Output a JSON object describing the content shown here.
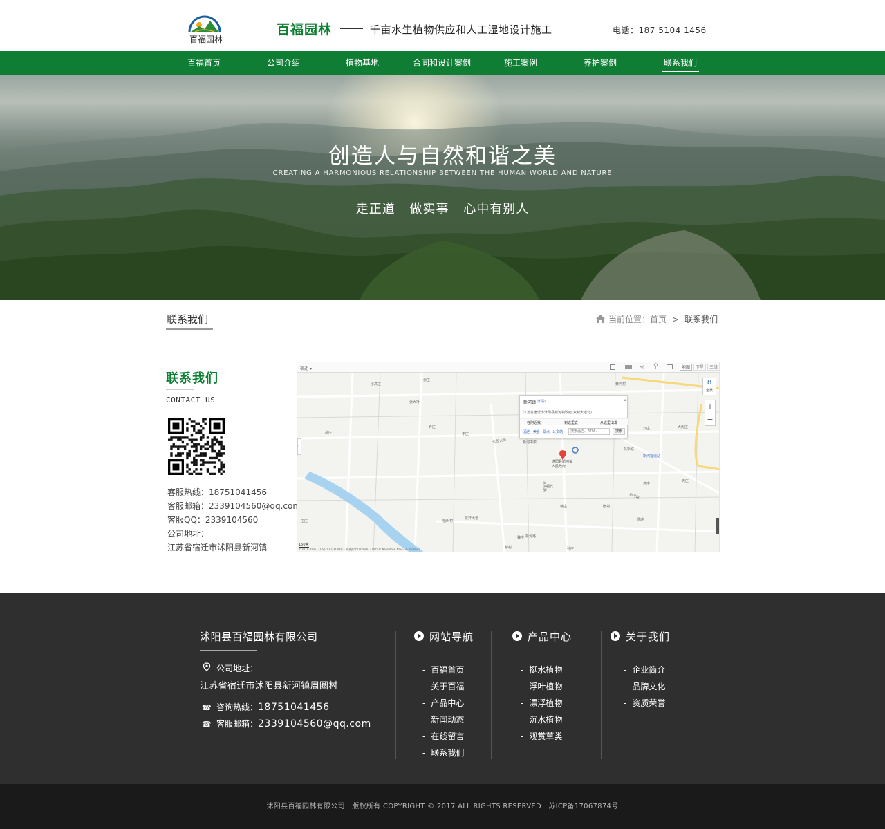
{
  "header": {
    "logo_text": "百福园林",
    "brand": "百福园林",
    "tagline": "千亩水生植物供应和人工湿地设计施工",
    "phone": "电话：187 5104 1456"
  },
  "nav": {
    "items": [
      "百福首页",
      "公司介绍",
      "植物基地",
      "合同和设计案例",
      "施工案例",
      "养护案例",
      "联系我们"
    ],
    "active": "联系我们"
  },
  "banner": {
    "title": "创造人与自然和谐之美",
    "subtitle": "CREATING A HARMONIOUS RELATIONSHIP BETWEEN THE HUMAN WORLD AND NATURE",
    "slogan": "走正道 做实事 心中有别人"
  },
  "section": {
    "title": "联系我们",
    "breadcrumb_label": "当前位置：",
    "breadcrumb_home": "首页",
    "breadcrumb_sep": ">",
    "breadcrumb_current": "联系我们"
  },
  "contact": {
    "title": "联系我们",
    "subtitle": "CONTACT US",
    "hotline": "客服热线：18751041456",
    "email": "客服邮箱：2339104560@qq.com",
    "qq": "客服QQ：2339104560",
    "address_label": "公司地址：",
    "address": "江苏省宿迁市沭阳县新河镇"
  },
  "map": {
    "city_select": "宿迁 ▾",
    "view_buttons": [
      "地图",
      "卫星",
      "三维"
    ],
    "popup_title": "新河镇",
    "popup_detail": "详情»",
    "popup_address": "江苏省宿迁市沭阳县新河镇政府(双新大道北)",
    "popup_actions": [
      "在附近找",
      "到这里去",
      "从这里出发"
    ],
    "popup_links": [
      "酒店",
      "美食",
      "景点",
      "公交站"
    ],
    "popup_search_placeholder": "搜索酒店、ATM...",
    "popup_search_button": "搜索",
    "marker_label": "沭阳县新河镇人民政府",
    "places": [
      "小高庄",
      "张庄",
      "张大圩",
      "乔庄",
      "于庄",
      "新河中学",
      "徐庄",
      "张刘",
      "黄河村",
      "刘庄",
      "大周庄",
      "新河客运站",
      "老庄",
      "天庄",
      "庄庄",
      "柏树村",
      "魏庄",
      "孙庄",
      "陈庄",
      "祖代",
      "高庄",
      "新村"
    ],
    "roads": [
      "花园大街",
      "扎新路",
      "新河路",
      "富民路",
      "花开大道",
      "新河路"
    ],
    "scale": "150米",
    "copyright": "©2018 Baidu - GS(2017)3199号 - 甲测资字1100930 - Data© NavInfo & Navi2 & PalmGO",
    "zoom_in": "+",
    "zoom_out": "−",
    "panorama": "全景"
  },
  "footer": {
    "company": "沭阳县百福园林有限公司",
    "address_label": "公司地址：",
    "address": "江苏省宿迁市沭阳县新河镇周圈村",
    "hotline_label": "咨询热线：",
    "hotline": "18751041456",
    "email_label": "客服邮箱：",
    "email": "2339104560@qq.com",
    "col1_title": "网站导航",
    "col1_items": [
      "百福首页",
      "关于百福",
      "产品中心",
      "新闻动态",
      "在线留言",
      "联系我们"
    ],
    "col2_title": "产品中心",
    "col2_items": [
      "挺水植物",
      "浮叶植物",
      "漂浮植物",
      "沉水植物",
      "观赏草类"
    ],
    "col3_title": "关于我们",
    "col3_items": [
      "企业简介",
      "品牌文化",
      "资质荣誉"
    ],
    "copyright": "沭阳县百福园林有限公司   版权所有 COPYRIGHT © 2017 ALL RIGHTS RESERVED   苏ICP备17067874号"
  },
  "colors": {
    "brand_green": "#0f7e34",
    "footer_bg": "#2f2f2f",
    "copyright_bg": "#1a1a1a"
  }
}
